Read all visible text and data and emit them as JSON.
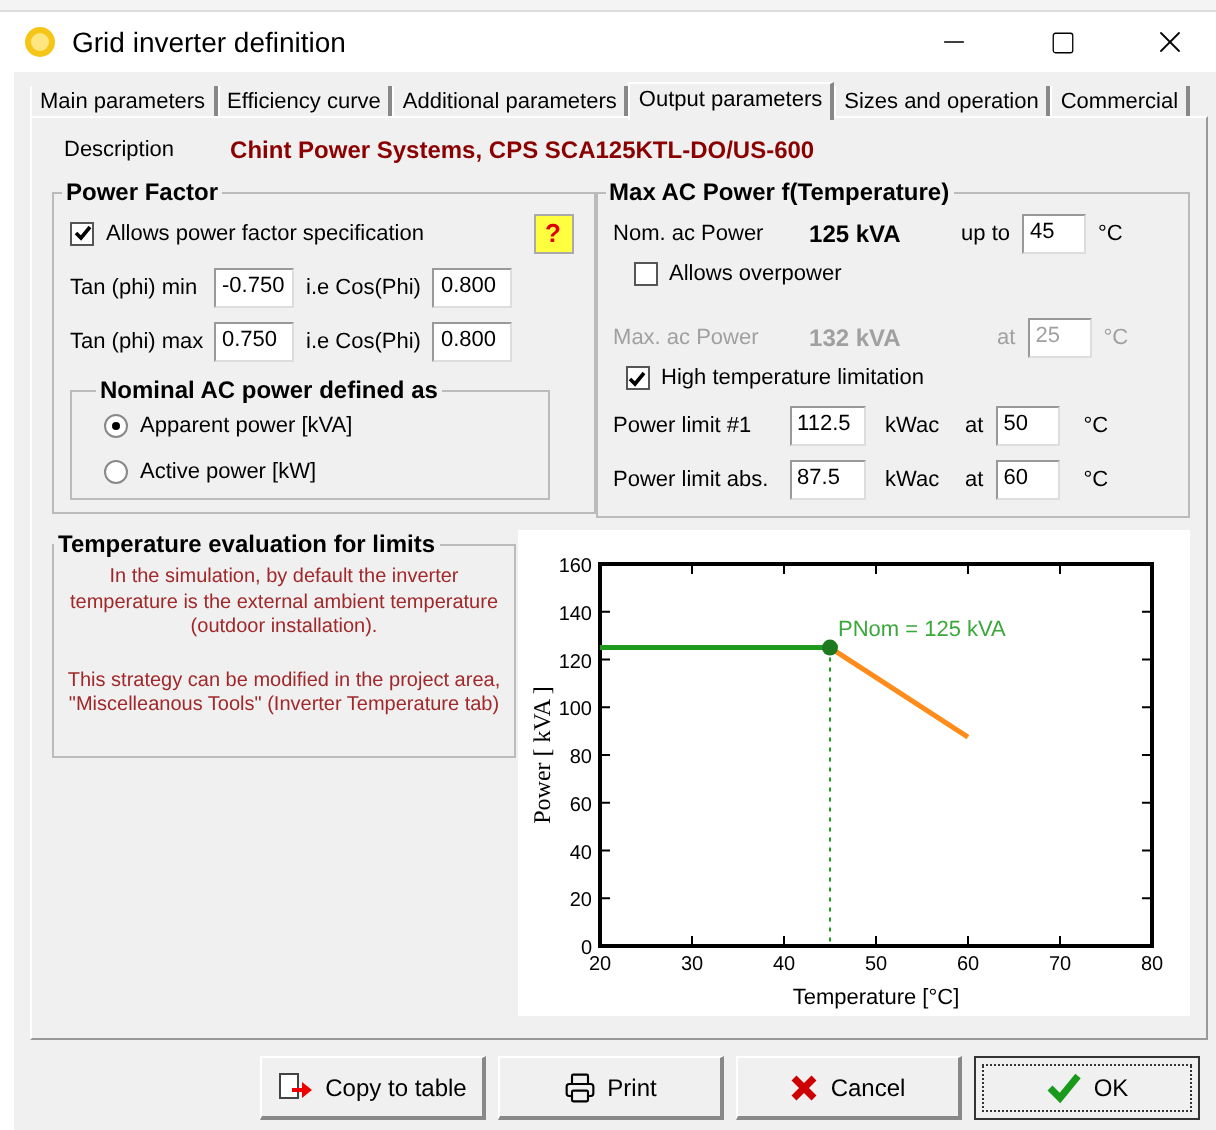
{
  "window": {
    "title": "Grid inverter definition"
  },
  "tabs": [
    {
      "label": "Main parameters",
      "selected": false
    },
    {
      "label": "Efficiency curve",
      "selected": false
    },
    {
      "label": "Additional parameters",
      "selected": false
    },
    {
      "label": "Output parameters",
      "selected": true
    },
    {
      "label": "Sizes and operation",
      "selected": false
    },
    {
      "label": "Commercial",
      "selected": false
    }
  ],
  "description": {
    "label": "Description",
    "value": "Chint Power Systems,  CPS SCA125KTL-DO/US-600"
  },
  "power_factor": {
    "title": "Power Factor",
    "allow": {
      "label": "Allows power factor specification",
      "checked": true
    },
    "help": "?",
    "rows": [
      {
        "label": "Tan (phi) min",
        "tan": "-0.750",
        "cos_label": "i.e Cos(Phi)",
        "cos": "0.800"
      },
      {
        "label": "Tan (phi) max",
        "tan": "0.750",
        "cos_label": "i.e Cos(Phi)",
        "cos": "0.800"
      }
    ],
    "nominal": {
      "title": "Nominal AC power defined as",
      "options": [
        {
          "label": "Apparent power  [kVA]",
          "selected": true
        },
        {
          "label": "Active power  [kW]",
          "selected": false
        }
      ]
    }
  },
  "max_ac": {
    "title": "Max AC Power  f(Temperature)",
    "nominal": {
      "label": "Nom. ac Power",
      "value": "125 kVA",
      "up_to": "up to",
      "temp": "45",
      "unit": "°C"
    },
    "overpower": {
      "label": "Allows overpower",
      "checked": false
    },
    "max": {
      "label": "Max. ac Power",
      "value": "132 kVA",
      "at": "at",
      "temp": "25",
      "unit": "°C",
      "disabled": true
    },
    "high_temp": {
      "label": "High temperature limitation",
      "checked": true
    },
    "limits": [
      {
        "label": "Power limit #1",
        "value": "112.5",
        "unit": "kWac",
        "at": "at",
        "temp": "50",
        "temp_unit": "°C"
      },
      {
        "label": "Power limit abs.",
        "value": "87.5",
        "unit": "kWac",
        "at": "at",
        "temp": "60",
        "temp_unit": "°C"
      }
    ]
  },
  "temp_eval": {
    "title": "Temperature evaluation for limits",
    "paragraphs": [
      "In the simulation, by default the inverter temperature is the external ambient temperature (outdoor installation).",
      "This strategy can be modified in the project area, \"Miscelleanous Tools\" (Inverter Temperature tab)"
    ]
  },
  "chart": {
    "chart_data": {
      "type": "line",
      "xlabel": "Temperature [°C]",
      "ylabel": "Power [ kVA ]",
      "x": [
        20,
        45,
        60
      ],
      "series": [
        {
          "color": "#1e9a1e",
          "values": [
            125,
            125,
            null
          ]
        },
        {
          "color": "#ff8c1a",
          "values": [
            null,
            125,
            87.5
          ]
        }
      ],
      "xlim": [
        20,
        80
      ],
      "ylim": [
        0,
        160
      ],
      "xticks": [
        20,
        30,
        40,
        50,
        60,
        70,
        80
      ],
      "yticks": [
        0,
        20,
        40,
        60,
        80,
        100,
        120,
        140,
        160
      ],
      "annotations": [
        {
          "text": "PNom = 125  kVA",
          "x": 45,
          "y": 125
        }
      ]
    }
  },
  "buttons": [
    {
      "label": "Copy to table",
      "kind": "copy",
      "default": false
    },
    {
      "label": "Print",
      "kind": "print",
      "default": false
    },
    {
      "label": "Cancel",
      "kind": "cancel",
      "default": false
    },
    {
      "label": "OK",
      "kind": "ok",
      "default": true
    }
  ]
}
